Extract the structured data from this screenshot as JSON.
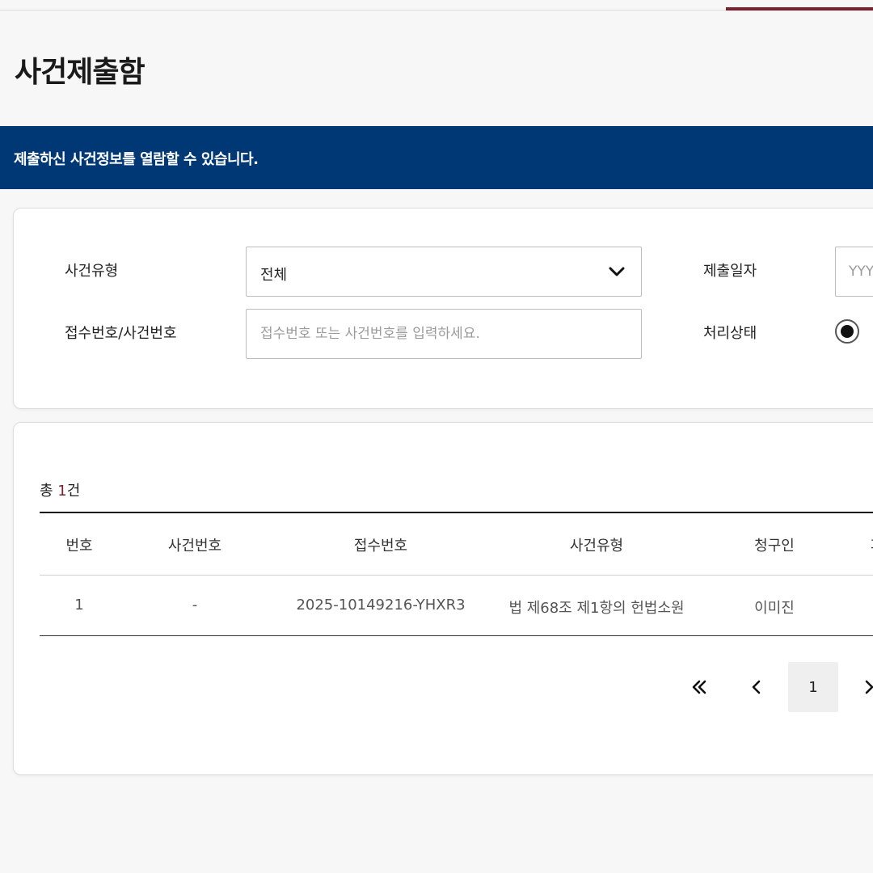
{
  "page": {
    "title": "사건제출함",
    "notice": "제출하신 사건정보를 열람할 수 있습니다."
  },
  "filter": {
    "case_type_label": "사건유형",
    "case_type_value": "전체",
    "number_label": "접수번호/사건번호",
    "number_placeholder": "접수번호 또는 사건번호를 입력하세요.",
    "date_label": "제출일자",
    "date_placeholder": "YYYY",
    "status_label": "처리상태"
  },
  "list": {
    "total_prefix": "총 ",
    "total_count": "1",
    "total_suffix": "건",
    "columns": [
      "번호",
      "사건번호",
      "접수번호",
      "사건유형",
      "청구인",
      "피"
    ],
    "rows": [
      [
        "1",
        "-",
        "2025-10149216-YHXR3",
        "법 제68조 제1항의 헌법소원",
        "이미진"
      ]
    ]
  },
  "pagination": {
    "current_page": "1"
  },
  "colors": {
    "banner": "#003876",
    "accent": "#7b1f2c"
  }
}
